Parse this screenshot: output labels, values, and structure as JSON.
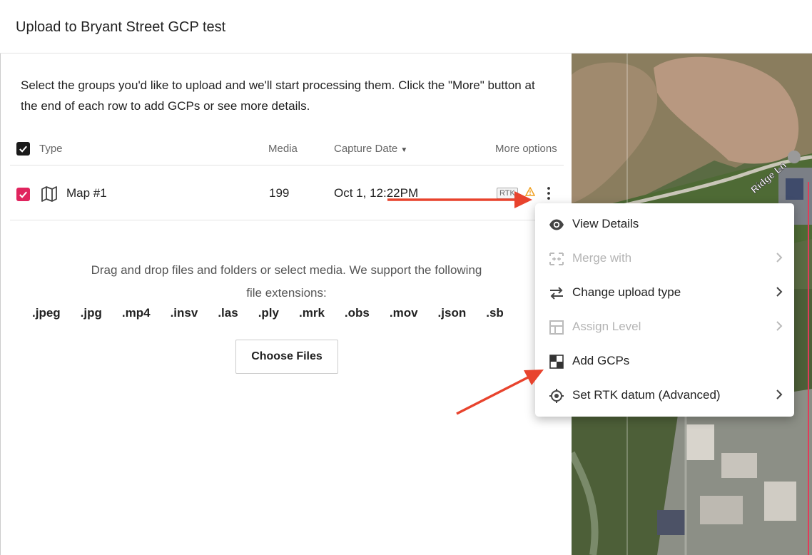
{
  "dialog": {
    "title": "Upload to Bryant Street GCP test"
  },
  "intro": "Select the groups you'd like to upload and we'll start processing them. Click the \"More\" button at the end of each row to add GCPs or see more details.",
  "table": {
    "headers": {
      "type": "Type",
      "media": "Media",
      "capture_date": "Capture Date",
      "more": "More options"
    },
    "rows": [
      {
        "name": "Map #1",
        "media": "199",
        "date": "Oct 1, 12:22PM",
        "badge": "RTK"
      }
    ]
  },
  "dropzone": {
    "text": "Drag and drop files and folders or select media. We support the following file extensions:",
    "extensions": [
      ".jpeg",
      ".jpg",
      ".mp4",
      ".insv",
      ".las",
      ".ply",
      ".mrk",
      ".obs",
      ".mov",
      ".json",
      ".sb"
    ],
    "button": "Choose Files"
  },
  "map": {
    "road_label": "Ridge Ln"
  },
  "menu": {
    "items": [
      {
        "label": "View Details",
        "icon": "eye-icon",
        "disabled": false,
        "submenu": false
      },
      {
        "label": "Merge with",
        "icon": "merge-icon",
        "disabled": true,
        "submenu": true
      },
      {
        "label": "Change upload type",
        "icon": "swap-icon",
        "disabled": false,
        "submenu": true
      },
      {
        "label": "Assign Level",
        "icon": "level-icon",
        "disabled": true,
        "submenu": true
      },
      {
        "label": "Add GCPs",
        "icon": "gcp-icon",
        "disabled": false,
        "submenu": false
      },
      {
        "label": "Set RTK datum (Advanced)",
        "icon": "target-icon",
        "disabled": false,
        "submenu": true
      }
    ]
  },
  "colors": {
    "accent_checkbox": "#e0245e",
    "annotation_arrow": "#e8432d",
    "warning": "#f0a020"
  }
}
